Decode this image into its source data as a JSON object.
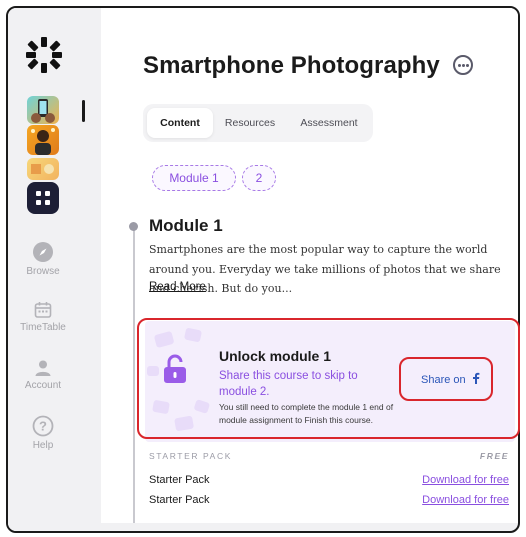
{
  "sidebar": {
    "nav": [
      {
        "label": "Browse",
        "icon": "compass-icon"
      },
      {
        "label": "TimeTable",
        "icon": "calendar-icon"
      },
      {
        "label": "Account",
        "icon": "user-icon"
      },
      {
        "label": "Help",
        "icon": "help-icon"
      }
    ],
    "courses": [
      "course-thumbnail-phone",
      "course-thumbnail-person",
      "course-thumbnail-shapes"
    ]
  },
  "main": {
    "title": "Smartphone Photography",
    "tabs": [
      {
        "label": "Content",
        "active": true
      },
      {
        "label": "Resources",
        "active": false
      },
      {
        "label": "Assessment",
        "active": false
      }
    ],
    "modules": [
      "Module 1",
      "2"
    ],
    "module": {
      "title": "Module 1",
      "description": "Smartphones are the most popular way to capture the world around you. Everyday we take millions of photos that we share and cherish. But do you...",
      "read_more": "Read More"
    },
    "unlock": {
      "title": "Unlock module 1",
      "subtitle": "Share this course to skip to module 2.",
      "note": "You still need to complete the module 1 end of module assignment to Finish this course.",
      "share_label": "Share on"
    },
    "starter_pack": {
      "header": "STARTER PACK",
      "badge": "FREE",
      "items": [
        {
          "name": "Starter Pack",
          "link": "Download for free"
        },
        {
          "name": "Starter Pack",
          "link": "Download for free"
        }
      ]
    }
  },
  "colors": {
    "accent": "#8a4fe0",
    "highlight": "#d9262c",
    "card_bg": "#f4eefc",
    "sidebar_bg": "#f1f1f3"
  }
}
